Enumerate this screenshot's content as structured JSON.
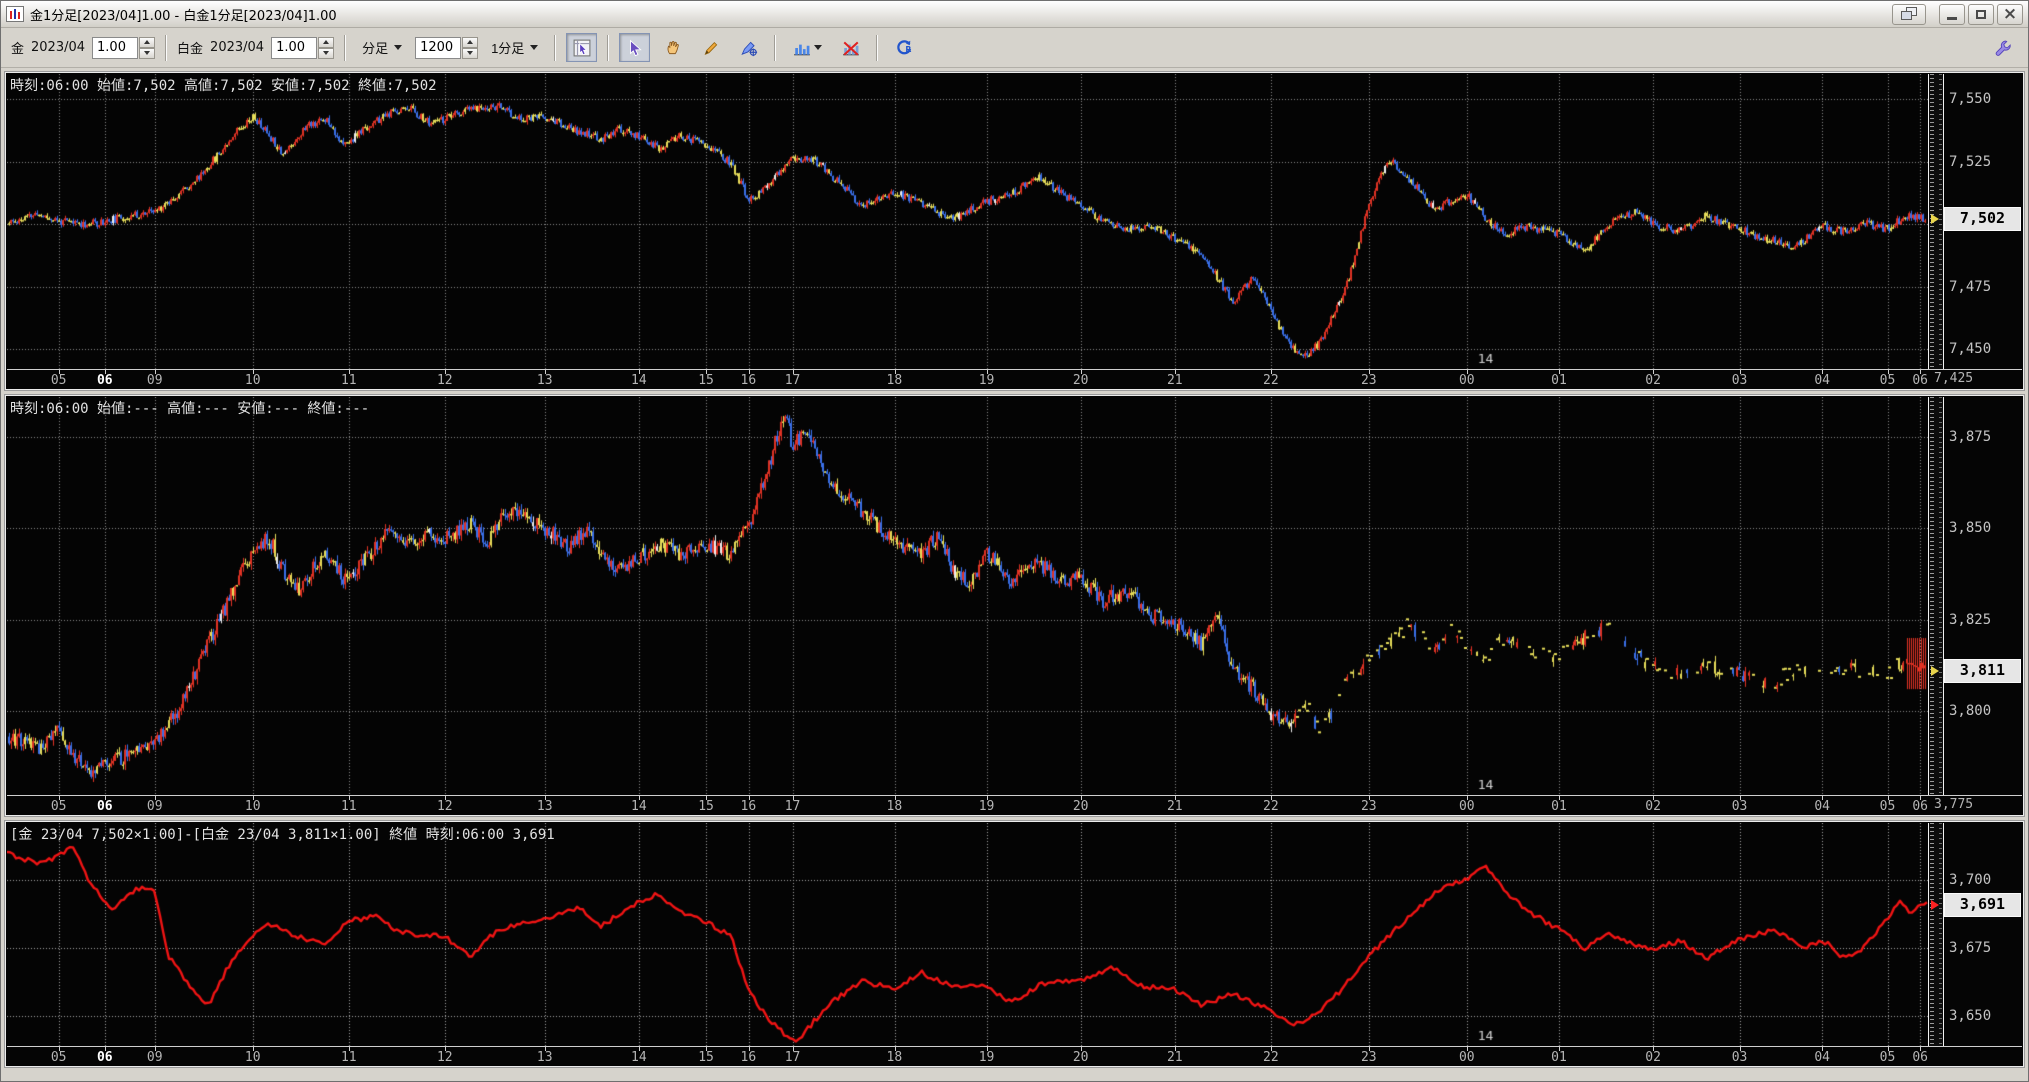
{
  "window": {
    "title": "金1分足[2023/04]1.00 - 白金1分足[2023/04]1.00",
    "icon": "candlestick-chart-icon",
    "controls": [
      "cascade-windows",
      "minimize",
      "maximize",
      "close"
    ]
  },
  "toolbar": {
    "gold": {
      "label": "金",
      "contract": "2023/04",
      "multiplier": "1.00"
    },
    "platinum": {
      "label": "白金",
      "contract": "2023/04",
      "multiplier": "1.00"
    },
    "bar_type": "分足",
    "bar_count": "1200",
    "bar_interval": "1分足",
    "tools": [
      "chart-pointer",
      "pointer",
      "pan-hand",
      "draw-pencil",
      "draw-pen-crosshair",
      "chart-style",
      "chart-remove",
      "refresh",
      "settings-wrench"
    ]
  },
  "style": {
    "plot_bg": "#040404",
    "up": "#e03224",
    "down": "#3a6fe8",
    "doji": "#e6dd5a",
    "line": "#f01414",
    "highlight_bg": "#e6e6e6"
  },
  "x_axis": {
    "date_label": {
      "text": "14",
      "pos": 0.764
    },
    "ticks": [
      {
        "label": "05",
        "pos": 0.027
      },
      {
        "label": "06",
        "pos": 0.051,
        "bold": true
      },
      {
        "label": "09",
        "pos": 0.077
      },
      {
        "label": "10",
        "pos": 0.128
      },
      {
        "label": "11",
        "pos": 0.178
      },
      {
        "label": "12",
        "pos": 0.228
      },
      {
        "label": "13",
        "pos": 0.28
      },
      {
        "label": "14",
        "pos": 0.329
      },
      {
        "label": "15",
        "pos": 0.364
      },
      {
        "label": "16",
        "pos": 0.386
      },
      {
        "label": "17",
        "pos": 0.409
      },
      {
        "label": "18",
        "pos": 0.462
      },
      {
        "label": "19",
        "pos": 0.51
      },
      {
        "label": "20",
        "pos": 0.559
      },
      {
        "label": "21",
        "pos": 0.608
      },
      {
        "label": "22",
        "pos": 0.658
      },
      {
        "label": "23",
        "pos": 0.709
      },
      {
        "label": "00",
        "pos": 0.76
      },
      {
        "label": "01",
        "pos": 0.808
      },
      {
        "label": "02",
        "pos": 0.857
      },
      {
        "label": "03",
        "pos": 0.902
      },
      {
        "label": "04",
        "pos": 0.945
      },
      {
        "label": "05",
        "pos": 0.979
      },
      {
        "label": "06",
        "pos": 0.996
      }
    ]
  },
  "chart_data": [
    {
      "name": "gold-1min",
      "type": "candlestick",
      "info": "時刻:06:00 始値:7,502 高値:7,502 安値:7,502 終値:7,502",
      "current": {
        "v": 7502,
        "label": "7,502",
        "marker": "#e8d44d"
      },
      "corner_label": "7,425",
      "y_range": [
        7560,
        7442
      ],
      "grid_color": "#8d8d8d",
      "seed": 11,
      "amp": 2.0,
      "wick": 1.1,
      "y_ticks": [
        {
          "v": 7550,
          "label": "7,550"
        },
        {
          "v": 7525,
          "label": "7,525"
        },
        {
          "v": 7500,
          "label": ""
        },
        {
          "v": 7475,
          "label": "7,475"
        },
        {
          "v": 7450,
          "label": "7,450"
        }
      ],
      "anchors": [
        [
          0,
          7500
        ],
        [
          0.016,
          7504
        ],
        [
          0.027,
          7501
        ],
        [
          0.042,
          7500
        ],
        [
          0.051,
          7501
        ],
        [
          0.063,
          7503
        ],
        [
          0.077,
          7505
        ],
        [
          0.089,
          7512
        ],
        [
          0.099,
          7518
        ],
        [
          0.11,
          7528
        ],
        [
          0.12,
          7538
        ],
        [
          0.128,
          7543
        ],
        [
          0.136,
          7536
        ],
        [
          0.144,
          7528
        ],
        [
          0.157,
          7540
        ],
        [
          0.167,
          7542
        ],
        [
          0.175,
          7531
        ],
        [
          0.186,
          7538
        ],
        [
          0.199,
          7544
        ],
        [
          0.209,
          7547
        ],
        [
          0.22,
          7540
        ],
        [
          0.228,
          7542
        ],
        [
          0.241,
          7546
        ],
        [
          0.256,
          7547
        ],
        [
          0.267,
          7542
        ],
        [
          0.28,
          7543
        ],
        [
          0.293,
          7538
        ],
        [
          0.309,
          7534
        ],
        [
          0.319,
          7538
        ],
        [
          0.329,
          7535
        ],
        [
          0.34,
          7530
        ],
        [
          0.35,
          7535
        ],
        [
          0.364,
          7532
        ],
        [
          0.377,
          7524
        ],
        [
          0.386,
          7510
        ],
        [
          0.395,
          7514
        ],
        [
          0.409,
          7527
        ],
        [
          0.421,
          7525
        ],
        [
          0.434,
          7516
        ],
        [
          0.445,
          7507
        ],
        [
          0.462,
          7513
        ],
        [
          0.476,
          7508
        ],
        [
          0.492,
          7502
        ],
        [
          0.51,
          7509
        ],
        [
          0.523,
          7512
        ],
        [
          0.536,
          7519
        ],
        [
          0.549,
          7512
        ],
        [
          0.559,
          7508
        ],
        [
          0.57,
          7501
        ],
        [
          0.583,
          7498
        ],
        [
          0.596,
          7499
        ],
        [
          0.608,
          7494
        ],
        [
          0.622,
          7488
        ],
        [
          0.638,
          7469
        ],
        [
          0.649,
          7479
        ],
        [
          0.658,
          7465
        ],
        [
          0.667,
          7452
        ],
        [
          0.675,
          7447
        ],
        [
          0.683,
          7452
        ],
        [
          0.69,
          7463
        ],
        [
          0.698,
          7477
        ],
        [
          0.709,
          7508
        ],
        [
          0.719,
          7526
        ],
        [
          0.73,
          7518
        ],
        [
          0.743,
          7506
        ],
        [
          0.76,
          7512
        ],
        [
          0.769,
          7503
        ],
        [
          0.779,
          7496
        ],
        [
          0.792,
          7499
        ],
        [
          0.808,
          7496
        ],
        [
          0.821,
          7489
        ],
        [
          0.834,
          7500
        ],
        [
          0.847,
          7505
        ],
        [
          0.857,
          7500
        ],
        [
          0.871,
          7497
        ],
        [
          0.884,
          7503
        ],
        [
          0.902,
          7498
        ],
        [
          0.915,
          7494
        ],
        [
          0.931,
          7491
        ],
        [
          0.945,
          7499
        ],
        [
          0.957,
          7497
        ],
        [
          0.968,
          7500
        ],
        [
          0.979,
          7498
        ],
        [
          0.988,
          7503
        ],
        [
          1,
          7502
        ]
      ]
    },
    {
      "name": "platinum-1min",
      "type": "candlestick",
      "info": "時刻:06:00 始値:--- 高値:--- 安値:--- 終値:---",
      "current": {
        "v": 3811,
        "label": "3,811",
        "marker": "#e8d44d"
      },
      "corner_label": "3,775",
      "y_range": [
        3886,
        3777
      ],
      "grid_color": "#8d8d8d",
      "seed": 23,
      "amp": 2.6,
      "wick": 1.6,
      "sparse": [
        {
          "from": 0.67,
          "p": 0.4
        },
        {
          "from": 0.85,
          "p": 0.55
        }
      ],
      "end_spike": {
        "from": 0.989,
        "hi": 3820,
        "lo": 3806
      },
      "y_ticks": [
        {
          "v": 3875,
          "label": "3,875"
        },
        {
          "v": 3850,
          "label": "3,850"
        },
        {
          "v": 3825,
          "label": "3,825"
        },
        {
          "v": 3800,
          "label": "3,800"
        }
      ],
      "anchors": [
        [
          0,
          3793
        ],
        [
          0.016,
          3790
        ],
        [
          0.027,
          3795
        ],
        [
          0.035,
          3788
        ],
        [
          0.042,
          3783
        ],
        [
          0.051,
          3785
        ],
        [
          0.063,
          3788
        ],
        [
          0.077,
          3792
        ],
        [
          0.089,
          3800
        ],
        [
          0.099,
          3812
        ],
        [
          0.11,
          3824
        ],
        [
          0.12,
          3836
        ],
        [
          0.128,
          3843
        ],
        [
          0.136,
          3848
        ],
        [
          0.144,
          3838
        ],
        [
          0.152,
          3833
        ],
        [
          0.16,
          3840
        ],
        [
          0.167,
          3843
        ],
        [
          0.175,
          3836
        ],
        [
          0.186,
          3841
        ],
        [
          0.199,
          3850
        ],
        [
          0.209,
          3845
        ],
        [
          0.22,
          3848
        ],
        [
          0.228,
          3847
        ],
        [
          0.241,
          3852
        ],
        [
          0.25,
          3846
        ],
        [
          0.256,
          3852
        ],
        [
          0.267,
          3855
        ],
        [
          0.28,
          3850
        ],
        [
          0.293,
          3845
        ],
        [
          0.302,
          3850
        ],
        [
          0.309,
          3843
        ],
        [
          0.319,
          3839
        ],
        [
          0.329,
          3842
        ],
        [
          0.34,
          3846
        ],
        [
          0.35,
          3843
        ],
        [
          0.364,
          3846
        ],
        [
          0.377,
          3843
        ],
        [
          0.386,
          3851
        ],
        [
          0.395,
          3864
        ],
        [
          0.401,
          3876
        ],
        [
          0.405,
          3882
        ],
        [
          0.409,
          3872
        ],
        [
          0.416,
          3878
        ],
        [
          0.423,
          3869
        ],
        [
          0.43,
          3861
        ],
        [
          0.445,
          3855
        ],
        [
          0.462,
          3846
        ],
        [
          0.476,
          3843
        ],
        [
          0.486,
          3849
        ],
        [
          0.492,
          3838
        ],
        [
          0.502,
          3835
        ],
        [
          0.51,
          3843
        ],
        [
          0.523,
          3836
        ],
        [
          0.536,
          3841
        ],
        [
          0.549,
          3835
        ],
        [
          0.559,
          3837
        ],
        [
          0.57,
          3830
        ],
        [
          0.583,
          3833
        ],
        [
          0.596,
          3826
        ],
        [
          0.608,
          3824
        ],
        [
          0.622,
          3818
        ],
        [
          0.63,
          3826
        ],
        [
          0.638,
          3812
        ],
        [
          0.649,
          3806
        ],
        [
          0.658,
          3799
        ],
        [
          0.667,
          3797
        ],
        [
          0.675,
          3803
        ],
        [
          0.683,
          3794
        ],
        [
          0.69,
          3800
        ],
        [
          0.698,
          3808
        ],
        [
          0.709,
          3814
        ],
        [
          0.719,
          3818
        ],
        [
          0.73,
          3824
        ],
        [
          0.743,
          3816
        ],
        [
          0.752,
          3822
        ],
        [
          0.76,
          3818
        ],
        [
          0.769,
          3814
        ],
        [
          0.779,
          3820
        ],
        [
          0.792,
          3816
        ],
        [
          0.808,
          3815
        ],
        [
          0.821,
          3820
        ],
        [
          0.834,
          3824
        ],
        [
          0.847,
          3816
        ],
        [
          0.857,
          3812
        ],
        [
          0.871,
          3810
        ],
        [
          0.884,
          3813
        ],
        [
          0.902,
          3810
        ],
        [
          0.915,
          3807
        ],
        [
          0.931,
          3811
        ],
        [
          0.945,
          3810
        ],
        [
          0.957,
          3812
        ],
        [
          0.968,
          3811
        ],
        [
          0.979,
          3810
        ],
        [
          0.988,
          3814
        ],
        [
          1,
          3811
        ]
      ]
    },
    {
      "name": "gold-platinum-spread",
      "type": "line",
      "info": "[金 23/04 7,502×1.00]-[白金 23/04 3,811×1.00] 終値 時刻:06:00 3,691",
      "current": {
        "v": 3691,
        "label": "3,691",
        "marker": "#ff2222"
      },
      "corner_label": "",
      "y_range": [
        3721,
        3639
      ],
      "grid_color": "#a8a8a8",
      "seed": 31,
      "amp": 1.6,
      "y_ticks": [
        {
          "v": 3700,
          "label": "3,700"
        },
        {
          "v": 3675,
          "label": "3,675"
        },
        {
          "v": 3650,
          "label": "3,650"
        }
      ],
      "anchors": [
        [
          0,
          3710
        ],
        [
          0.016,
          3706
        ],
        [
          0.027,
          3709
        ],
        [
          0.034,
          3712
        ],
        [
          0.042,
          3701
        ],
        [
          0.051,
          3692
        ],
        [
          0.055,
          3688
        ],
        [
          0.063,
          3695
        ],
        [
          0.071,
          3698
        ],
        [
          0.077,
          3695
        ],
        [
          0.084,
          3672
        ],
        [
          0.092,
          3664
        ],
        [
          0.099,
          3657
        ],
        [
          0.105,
          3654
        ],
        [
          0.115,
          3668
        ],
        [
          0.128,
          3680
        ],
        [
          0.136,
          3684
        ],
        [
          0.152,
          3679
        ],
        [
          0.167,
          3677
        ],
        [
          0.178,
          3685
        ],
        [
          0.193,
          3687
        ],
        [
          0.204,
          3681
        ],
        [
          0.228,
          3679
        ],
        [
          0.241,
          3672
        ],
        [
          0.256,
          3682
        ],
        [
          0.28,
          3686
        ],
        [
          0.298,
          3690
        ],
        [
          0.309,
          3683
        ],
        [
          0.329,
          3692
        ],
        [
          0.34,
          3695
        ],
        [
          0.35,
          3688
        ],
        [
          0.364,
          3685
        ],
        [
          0.377,
          3679
        ],
        [
          0.386,
          3660
        ],
        [
          0.395,
          3650
        ],
        [
          0.405,
          3643
        ],
        [
          0.412,
          3641
        ],
        [
          0.42,
          3648
        ],
        [
          0.429,
          3655
        ],
        [
          0.445,
          3663
        ],
        [
          0.462,
          3660
        ],
        [
          0.476,
          3666
        ],
        [
          0.492,
          3661
        ],
        [
          0.51,
          3661
        ],
        [
          0.523,
          3655
        ],
        [
          0.539,
          3662
        ],
        [
          0.559,
          3663
        ],
        [
          0.575,
          3668
        ],
        [
          0.591,
          3661
        ],
        [
          0.608,
          3660
        ],
        [
          0.622,
          3654
        ],
        [
          0.638,
          3658
        ],
        [
          0.658,
          3652
        ],
        [
          0.67,
          3647
        ],
        [
          0.68,
          3650
        ],
        [
          0.695,
          3660
        ],
        [
          0.709,
          3672
        ],
        [
          0.72,
          3680
        ],
        [
          0.737,
          3691
        ],
        [
          0.748,
          3698
        ],
        [
          0.76,
          3700
        ],
        [
          0.769,
          3706
        ],
        [
          0.779,
          3697
        ],
        [
          0.79,
          3689
        ],
        [
          0.808,
          3682
        ],
        [
          0.821,
          3675
        ],
        [
          0.834,
          3680
        ],
        [
          0.857,
          3674
        ],
        [
          0.871,
          3678
        ],
        [
          0.884,
          3671
        ],
        [
          0.902,
          3678
        ],
        [
          0.92,
          3682
        ],
        [
          0.936,
          3675
        ],
        [
          0.945,
          3678
        ],
        [
          0.957,
          3671
        ],
        [
          0.968,
          3676
        ],
        [
          0.979,
          3686
        ],
        [
          0.986,
          3693
        ],
        [
          0.991,
          3687
        ],
        [
          0.996,
          3691
        ],
        [
          1,
          3691
        ]
      ]
    }
  ]
}
